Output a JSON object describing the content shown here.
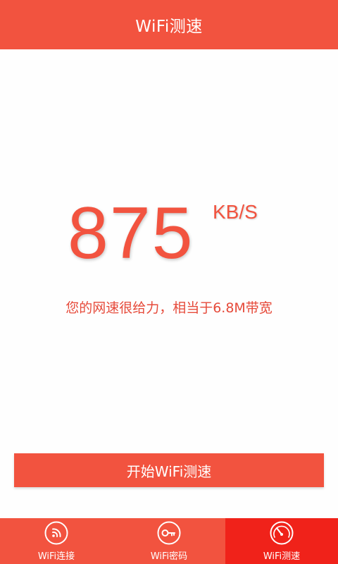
{
  "header": {
    "title": "WiFi测速"
  },
  "speed": {
    "value": "875",
    "unit": "KB/S",
    "description": "您的网速很给力，相当于6.8M带宽"
  },
  "actions": {
    "start_label": "开始WiFi测速"
  },
  "tabs": [
    {
      "label": "WiFi连接",
      "icon": "wifi-signal-icon",
      "active": false
    },
    {
      "label": "WiFi密码",
      "icon": "key-icon",
      "active": false
    },
    {
      "label": "WiFi测速",
      "icon": "speedometer-icon",
      "active": true
    }
  ],
  "colors": {
    "brand": "#f2533f",
    "active_tab": "#f0221a",
    "text_on_brand": "#ffffff"
  }
}
